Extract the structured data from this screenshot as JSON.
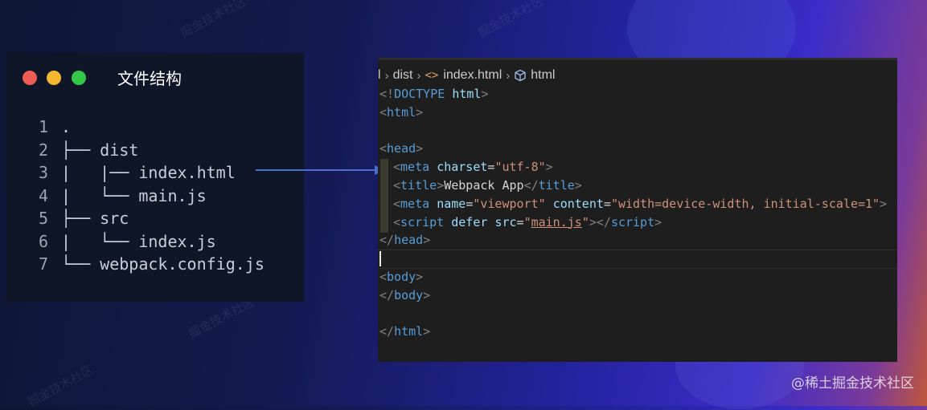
{
  "file_panel": {
    "title": "文件结构",
    "lines": [
      {
        "num": "1",
        "text": "."
      },
      {
        "num": "2",
        "text": "├── dist"
      },
      {
        "num": "3",
        "text": "|   |── index.html"
      },
      {
        "num": "4",
        "text": "|   └── main.js"
      },
      {
        "num": "5",
        "text": "├── src"
      },
      {
        "num": "6",
        "text": "|   └── index.js"
      },
      {
        "num": "7",
        "text": "└── webpack.config.js"
      }
    ]
  },
  "breadcrumb": {
    "seg0": "l",
    "seg1": "dist",
    "seg2": "index.html",
    "seg3": "html",
    "icons": [
      "chevron-right-icon",
      "code-icon",
      "cube-icon"
    ]
  },
  "code": {
    "doctype_open": "<!",
    "doctype_kw": "DOCTYPE",
    "doctype_html": "html",
    "doctype_close": ">",
    "tag_html": "html",
    "tag_head": "head",
    "tag_meta": "meta",
    "attr_charset": "charset",
    "val_charset": "\"utf-8\"",
    "tag_title": "title",
    "title_text": "Webpack App",
    "attr_name": "name",
    "val_name": "\"viewport\"",
    "attr_content": "content",
    "val_content": "\"width=device-width, initial-scale=1\"",
    "tag_script": "script",
    "attr_defer": "defer",
    "attr_src": "src",
    "val_src_q": "\"",
    "val_src": "main.js",
    "tag_body": "body"
  },
  "watermark": "掘金技术社区",
  "brand": "@稀土掘金技术社区",
  "colors": {
    "tag": "#569cd6",
    "attribute": "#9cdcfe",
    "string": "#ce9178",
    "punctuation": "#808080",
    "arrow": "#4a6fd1"
  }
}
